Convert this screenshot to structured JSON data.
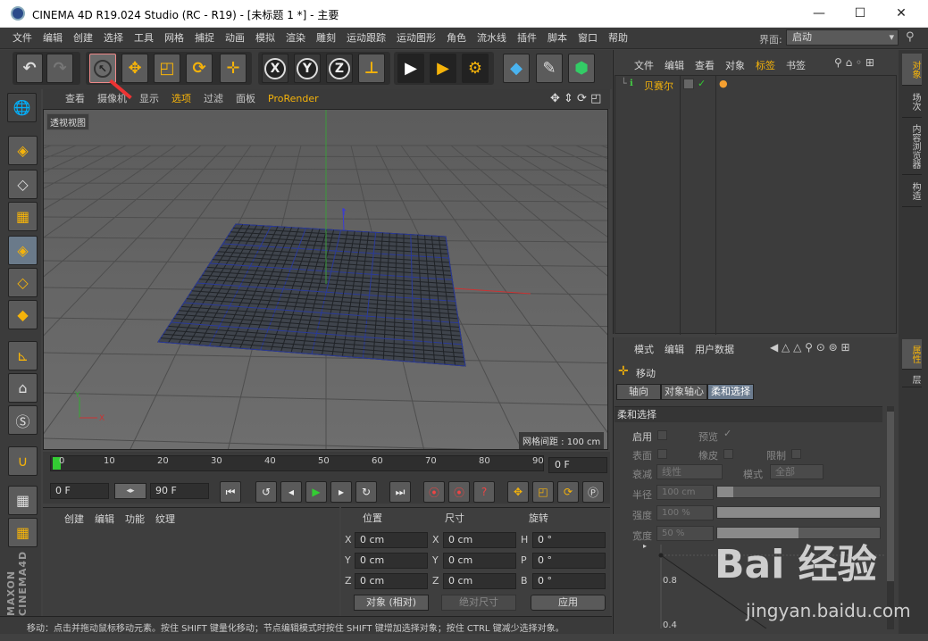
{
  "window": {
    "title": "CINEMA 4D R19.024 Studio (RC - R19) - [未标题 1 *] - 主要",
    "min": "—",
    "max": "☐",
    "close": "✕"
  },
  "menu": [
    "文件",
    "编辑",
    "创建",
    "选择",
    "工具",
    "网格",
    "捕捉",
    "动画",
    "模拟",
    "渲染",
    "雕刻",
    "运动跟踪",
    "运动图形",
    "角色",
    "流水线",
    "插件",
    "脚本",
    "窗口",
    "帮助"
  ],
  "layout": {
    "label": "界面:",
    "value": "启动"
  },
  "toolbar": {
    "move_x": "X",
    "move_y": "Y",
    "move_z": "Z"
  },
  "viewport": {
    "menus": [
      "查看",
      "摄像机",
      "显示",
      "选项",
      "过滤",
      "面板",
      "ProRender"
    ],
    "label": "透视视图",
    "grid_spacing": "网格间距 : 100 cm",
    "axis_y": "Y",
    "axis_x": "X"
  },
  "timeline": {
    "ticks": [
      "0",
      "10",
      "20",
      "30",
      "40",
      "50",
      "60",
      "70",
      "80",
      "90"
    ],
    "current_frame": "0 F"
  },
  "playback": {
    "start": "0 F",
    "end": "90 F"
  },
  "material": {
    "menus": [
      "创建",
      "编辑",
      "功能",
      "纹理"
    ]
  },
  "coords": {
    "headers": {
      "position": "位置",
      "size": "尺寸",
      "rotation": "旋转"
    },
    "rows": [
      {
        "a": "X",
        "pos": "0 cm",
        "b": "X",
        "size": "0 cm",
        "c": "H",
        "rot": "0 °"
      },
      {
        "a": "Y",
        "pos": "0 cm",
        "b": "Y",
        "size": "0 cm",
        "c": "P",
        "rot": "0 °"
      },
      {
        "a": "Z",
        "pos": "0 cm",
        "b": "Z",
        "size": "0 cm",
        "c": "B",
        "rot": "0 °"
      }
    ],
    "mode": "对象 (相对)",
    "size_mode": "绝对尺寸",
    "apply": "应用"
  },
  "status": "移动：点击并拖动鼠标移动元素。按住 SHIFT 键量化移动；节点编辑模式时按住 SHIFT 键增加选择对象；按住 CTRL 键减少选择对象。",
  "objects": {
    "menus": [
      "文件",
      "编辑",
      "查看",
      "对象",
      "标签",
      "书签"
    ],
    "items": [
      {
        "name": "贝赛尔"
      }
    ]
  },
  "attributes": {
    "menus": [
      "模式",
      "编辑",
      "用户数据"
    ],
    "tool_name": "移动",
    "tabs": [
      "轴向",
      "对象轴心",
      "柔和选择"
    ],
    "section": "柔和选择",
    "rows": {
      "enable": "启用",
      "preview": "预览",
      "surface": "表面",
      "rubber": "橡皮",
      "limit": "限制",
      "falloff": "衰减",
      "falloff_val": "线性",
      "mode": "模式",
      "mode_val": "全部",
      "radius": "半径",
      "radius_val": "100 cm",
      "strength": "强度",
      "strength_val": "100 %",
      "width": "宽度",
      "width_val": "50 %"
    },
    "graph_labels": [
      "0.8",
      "0.4"
    ]
  },
  "right_tabs": [
    "对象",
    "场次",
    "内容浏览器",
    "构造"
  ],
  "right_tabs2": [
    "属性",
    "层"
  ],
  "side_logo": "MAXON CINEMA4D",
  "watermark": {
    "text": "Bai 经验",
    "url": "jingyan.baidu.com"
  }
}
